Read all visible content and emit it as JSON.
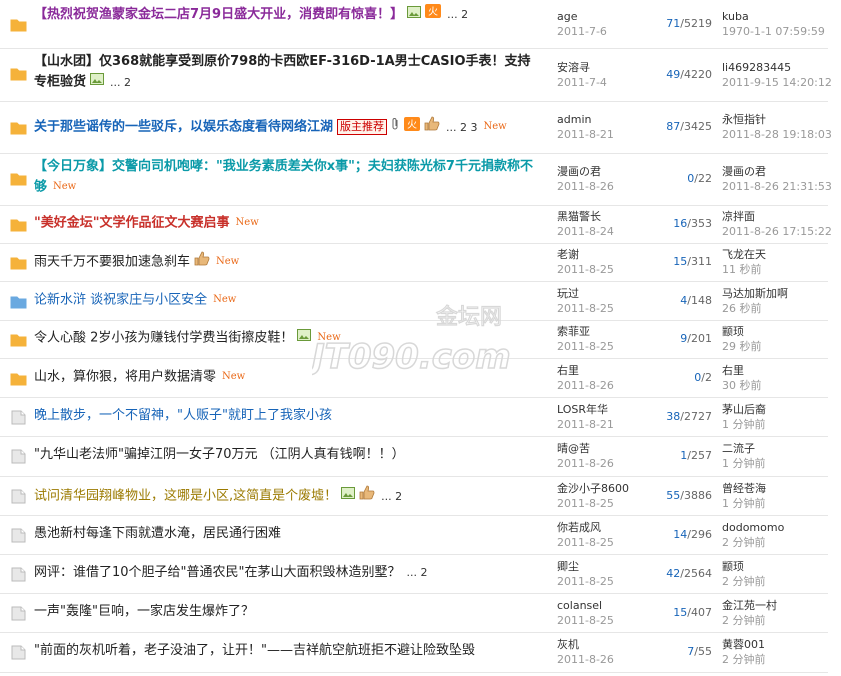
{
  "threads": [
    {
      "title": "【热烈祝贺渔蒙家金坛二店7月9日盛大开业，消费即有惊喜！】",
      "style": "purple",
      "folder": "orange",
      "icons": [
        "image",
        "hot"
      ],
      "pages": "... 2",
      "isNew": false,
      "author": "age",
      "date": "2011-7-6",
      "replies": "71",
      "views": "5219",
      "last_user": "kuba",
      "last_time": "1970-1-1 07:59:59"
    },
    {
      "title": "【山水团】仅368就能享受到原价798的卡西欧EF-316D-1A男士CASIO手表！支持专柜验货",
      "style": "black",
      "folder": "orange",
      "icons": [
        "image"
      ],
      "pages": "... 2",
      "isNew": false,
      "author": "安溶寻",
      "date": "2011-7-4",
      "replies": "49",
      "views": "4220",
      "last_user": "li469283445",
      "last_time": "2011-9-15 14:20:12"
    },
    {
      "title": "关于那些谣传的一些驳斥，以娱乐态度看待网络江湖",
      "style": "blue",
      "folder": "orange",
      "icons": [
        "badge",
        "attach",
        "hot",
        "thumb"
      ],
      "badge": "版主推荐",
      "pages": "... 2 3",
      "isNew": true,
      "author": "admin",
      "date": "2011-8-21",
      "replies": "87",
      "views": "3425",
      "last_user": "永恒指针",
      "last_time": "2011-8-28 19:18:03"
    },
    {
      "title": "【今日万象】交警向司机咆哮：\"我业务素质差关你x事\"；夫妇获陈光标7千元捐款称不够",
      "style": "cyan",
      "folder": "orange",
      "icons": [],
      "pages": "",
      "isNew": true,
      "author": "漫画の君",
      "date": "2011-8-26",
      "replies": "0",
      "views": "22",
      "last_user": "漫画の君",
      "last_time": "2011-8-26 21:31:53"
    },
    {
      "title": "\"美好金坛\"文学作品征文大赛启事",
      "style": "red",
      "folder": "orange",
      "icons": [],
      "pages": "",
      "isNew": true,
      "author": "黑猫警长",
      "date": "2011-8-24",
      "replies": "16",
      "views": "353",
      "last_user": "凉拌面",
      "last_time": "2011-8-26 17:15:22"
    },
    {
      "title": "雨天千万不要狠加速急刹车",
      "style": "plain",
      "folder": "orange",
      "icons": [
        "thumb"
      ],
      "pages": "",
      "isNew": true,
      "author": "老谢",
      "date": "2011-8-25",
      "replies": "15",
      "views": "311",
      "last_user": "飞龙在天",
      "last_time": "11 秒前"
    },
    {
      "title": "论新水浒 谈祝家庄与小区安全",
      "style": "plainblue",
      "folder": "blue",
      "icons": [],
      "pages": "",
      "isNew": true,
      "author": "玩过",
      "date": "2011-8-25",
      "replies": "4",
      "views": "148",
      "last_user": "马达加斯加啊",
      "last_time": "26 秒前"
    },
    {
      "title": "令人心酸 2岁小孩为赚钱付学费当街擦皮鞋！",
      "style": "plain",
      "folder": "orange",
      "icons": [
        "image"
      ],
      "pages": "",
      "isNew": true,
      "author": "索菲亚",
      "date": "2011-8-25",
      "replies": "9",
      "views": "201",
      "last_user": "颛顼",
      "last_time": "29 秒前"
    },
    {
      "title": "山水，算你狠，将用户数据清零",
      "style": "plain",
      "folder": "orange",
      "icons": [],
      "pages": "",
      "isNew": true,
      "author": "右里",
      "date": "2011-8-26",
      "replies": "0",
      "views": "2",
      "last_user": "右里",
      "last_time": "30 秒前"
    },
    {
      "title": "晚上散步，一个不留神，\"人贩子\"就盯上了我家小孩",
      "style": "plainblue",
      "folder": "gray",
      "icons": [],
      "pages": "",
      "isNew": false,
      "author": "LOSR年华",
      "date": "2011-8-21",
      "replies": "38",
      "views": "2727",
      "last_user": "茅山后裔",
      "last_time": "1 分钟前"
    },
    {
      "title": "\"九华山老法师\"骗掉江阴一女子70万元 （江阴人真有钱啊！！）",
      "style": "plain",
      "folder": "gray",
      "icons": [],
      "pages": "",
      "isNew": false,
      "author": "晴@苦",
      "date": "2011-8-26",
      "replies": "1",
      "views": "257",
      "last_user": "二流子",
      "last_time": "1 分钟前"
    },
    {
      "title": "试问清华园翔峰物业，这哪是小区,这简直是个废墟！",
      "style": "olive",
      "folder": "gray",
      "icons": [
        "image",
        "thumb"
      ],
      "pages": "... 2",
      "isNew": false,
      "author": "金沙小子8600",
      "date": "2011-8-25",
      "replies": "55",
      "views": "3886",
      "last_user": "曾经苍海",
      "last_time": "1 分钟前"
    },
    {
      "title": "愚池新村每逢下雨就遭水淹，居民通行困难",
      "style": "plain",
      "folder": "gray",
      "icons": [],
      "pages": "",
      "isNew": false,
      "author": "你若成风",
      "date": "2011-8-25",
      "replies": "14",
      "views": "296",
      "last_user": "dodomomo",
      "last_time": "2 分钟前"
    },
    {
      "title": "网评：谁借了10个胆子给\"普通农民\"在茅山大面积毁林造别墅？",
      "style": "plain",
      "folder": "gray",
      "icons": [],
      "pages": "... 2",
      "isNew": false,
      "author": "卿尘",
      "date": "2011-8-25",
      "replies": "42",
      "views": "2564",
      "last_user": "颛顼",
      "last_time": "2 分钟前"
    },
    {
      "title": "一声\"轰隆\"巨响，一家店发生爆炸了？",
      "style": "plain",
      "folder": "gray",
      "icons": [],
      "pages": "",
      "isNew": false,
      "author": "colansel",
      "date": "2011-8-25",
      "replies": "15",
      "views": "407",
      "last_user": "金江苑一村",
      "last_time": "2 分钟前"
    },
    {
      "title": "\"前面的灰机听着，老子没油了，让开！\"——吉祥航空航班拒不避让险致坠毁",
      "style": "plain",
      "folder": "gray",
      "icons": [],
      "pages": "",
      "isNew": false,
      "author": "灰机",
      "date": "2011-8-26",
      "replies": "7",
      "views": "55",
      "last_user": "黄蓉001",
      "last_time": "2 分钟前"
    }
  ],
  "labels": {
    "new": "New"
  },
  "watermark": {
    "text": "JT090.com",
    "sub": "金坛网"
  },
  "colors": {
    "folder_orange": "#f5b23a",
    "folder_blue": "#6aa9e0",
    "folder_gray": "#c8c8c8",
    "accent": "#1764b8",
    "new": "#ea6a1a"
  }
}
